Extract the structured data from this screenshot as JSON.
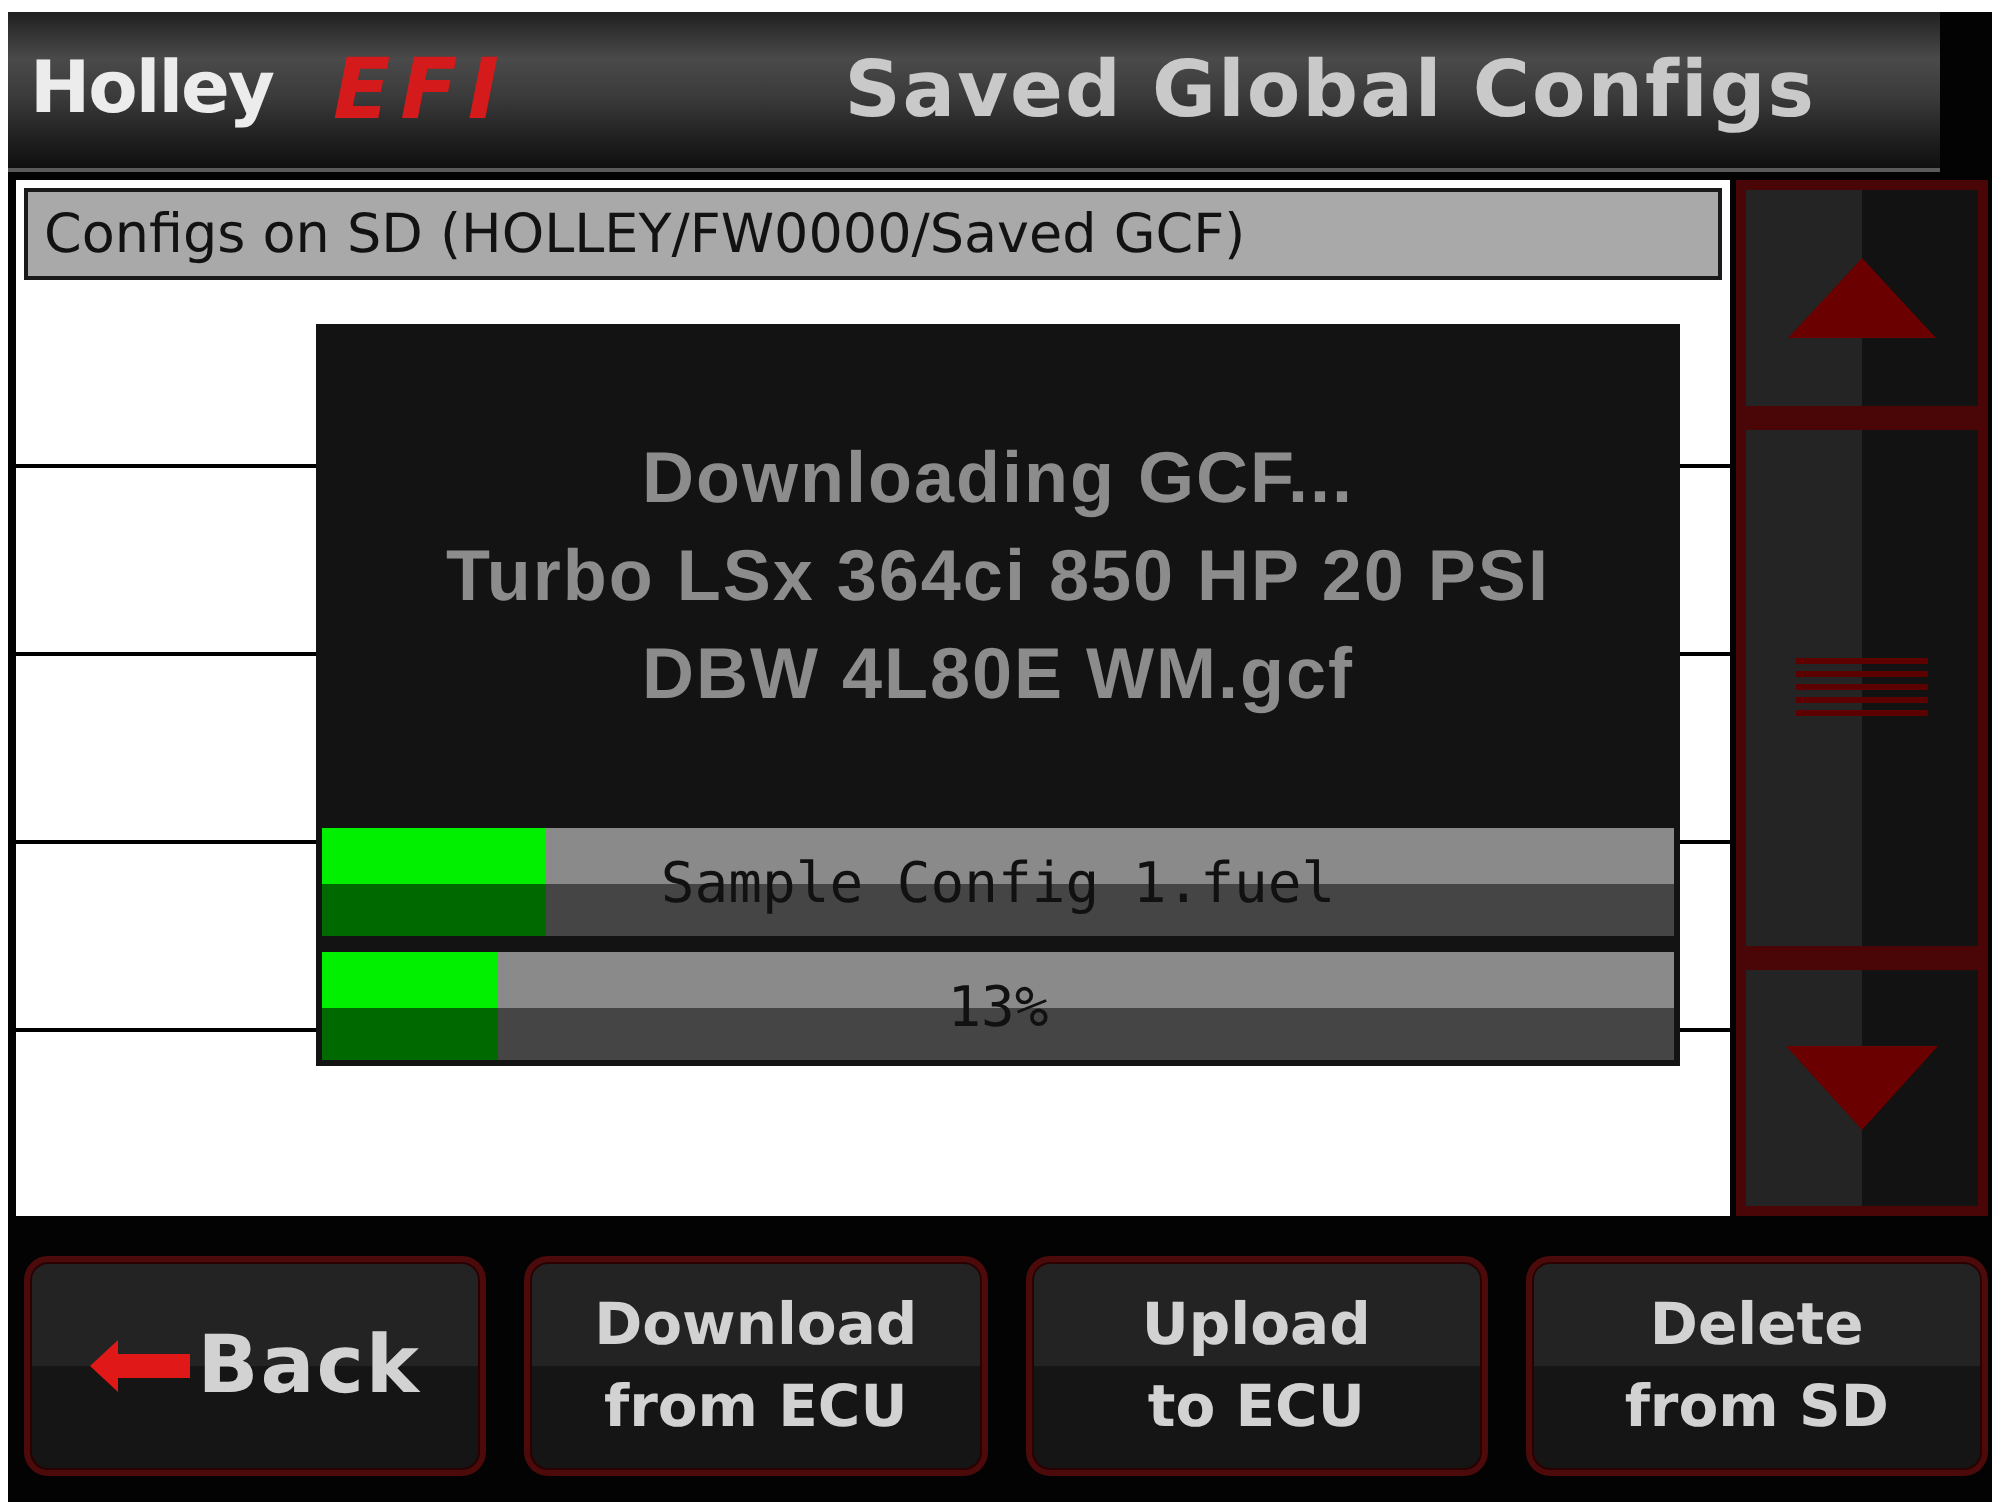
{
  "header": {
    "logo": {
      "wordmark": "Holley",
      "badge": "EFI"
    },
    "title": "Saved Global Configs"
  },
  "config_list": {
    "heading": "Configs on SD (HOLLEY/FW0000/Saved GCF)"
  },
  "progress_dialog": {
    "message_lines": [
      "Downloading GCF...",
      "Turbo LSx 364ci 850 HP 20 PSI",
      "DBW 4L80E WM.gcf"
    ],
    "progress_bars": [
      {
        "label": "Sample Config 1.fuel",
        "level": 0.165
      },
      {
        "label": "13%",
        "level": 0.13
      }
    ]
  },
  "buttons": [
    {
      "kind": "back",
      "lines": [
        "Back"
      ]
    },
    {
      "kind": "download",
      "lines": [
        "Download",
        "from ECU"
      ]
    },
    {
      "kind": "upload",
      "lines": [
        "Upload",
        "to ECU"
      ]
    },
    {
      "kind": "delete",
      "lines": [
        "Delete",
        "from SD"
      ]
    }
  ]
}
